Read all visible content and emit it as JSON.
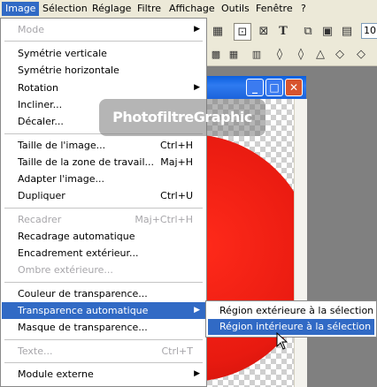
{
  "menubar": {
    "items": [
      {
        "label": "Image"
      },
      {
        "label": "Sélection"
      },
      {
        "label": "Réglage"
      },
      {
        "label": "Filtre"
      },
      {
        "label": "Affichage"
      },
      {
        "label": "Outils"
      },
      {
        "label": "Fenêtre"
      },
      {
        "label": "?"
      }
    ]
  },
  "toolbar": {
    "zoom_value": "10"
  },
  "watermark": "PhotofiltreGraphic",
  "image_menu": {
    "items": [
      {
        "label": "Mode"
      },
      {
        "label": "Symétrie verticale"
      },
      {
        "label": "Symétrie horizontale"
      },
      {
        "label": "Rotation"
      },
      {
        "label": "Incliner..."
      },
      {
        "label": "Décaler..."
      },
      {
        "label": "Taille de l'image...",
        "shortcut": "Ctrl+H"
      },
      {
        "label": "Taille de la zone de travail...",
        "shortcut": "Maj+H"
      },
      {
        "label": "Adapter l'image..."
      },
      {
        "label": "Dupliquer",
        "shortcut": "Ctrl+U"
      },
      {
        "label": "Recadrer",
        "shortcut": "Maj+Ctrl+H"
      },
      {
        "label": "Recadrage automatique"
      },
      {
        "label": "Encadrement extérieur..."
      },
      {
        "label": "Ombre extérieure..."
      },
      {
        "label": "Couleur de transparence..."
      },
      {
        "label": "Transparence automatique"
      },
      {
        "label": "Masque de transparence..."
      },
      {
        "label": "Texte...",
        "shortcut": "Ctrl+T"
      },
      {
        "label": "Module externe"
      }
    ]
  },
  "submenu": {
    "items": [
      {
        "label": "Région extérieure à la sélection"
      },
      {
        "label": "Région intérieure à la sélection"
      }
    ]
  }
}
